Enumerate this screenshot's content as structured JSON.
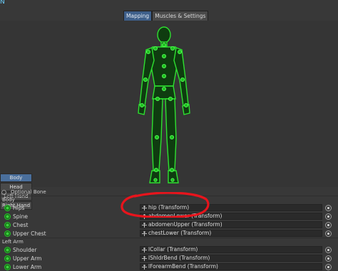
{
  "corner_glyph": "N",
  "tabs": [
    {
      "label": "Mapping",
      "active": true
    },
    {
      "label": "Muscles & Settings",
      "active": false
    }
  ],
  "body_parts": [
    {
      "label": "Body",
      "active": true
    },
    {
      "label": "Head",
      "active": false
    },
    {
      "label": "Left Hand",
      "active": false
    },
    {
      "label": "Right Hand",
      "active": false
    }
  ],
  "legend": {
    "optional_bone": "Optional Bone"
  },
  "sections": [
    {
      "title": "Body",
      "bones": [
        {
          "name": "Hips",
          "value": "hip (Transform)"
        },
        {
          "name": "Spine",
          "value": "abdomenLower (Transform)"
        },
        {
          "name": "Chest",
          "value": "abdomenUpper (Transform)"
        },
        {
          "name": "Upper Chest",
          "value": "chestLower (Transform)"
        }
      ]
    },
    {
      "title": "Left Arm",
      "bones": [
        {
          "name": "Shoulder",
          "value": "lCollar (Transform)"
        },
        {
          "name": "Upper Arm",
          "value": "lShldrBend (Transform)"
        },
        {
          "name": "Lower Arm",
          "value": "lForearmBend (Transform)"
        }
      ]
    }
  ],
  "colors": {
    "bone_green": "#2dc52f",
    "highlight_red": "#e8141c",
    "tab_active": "#3e5f8a"
  },
  "icons": {
    "bone_status": "green-bone-icon",
    "transform": "transform-icon",
    "object_picker": "object-picker-icon"
  }
}
